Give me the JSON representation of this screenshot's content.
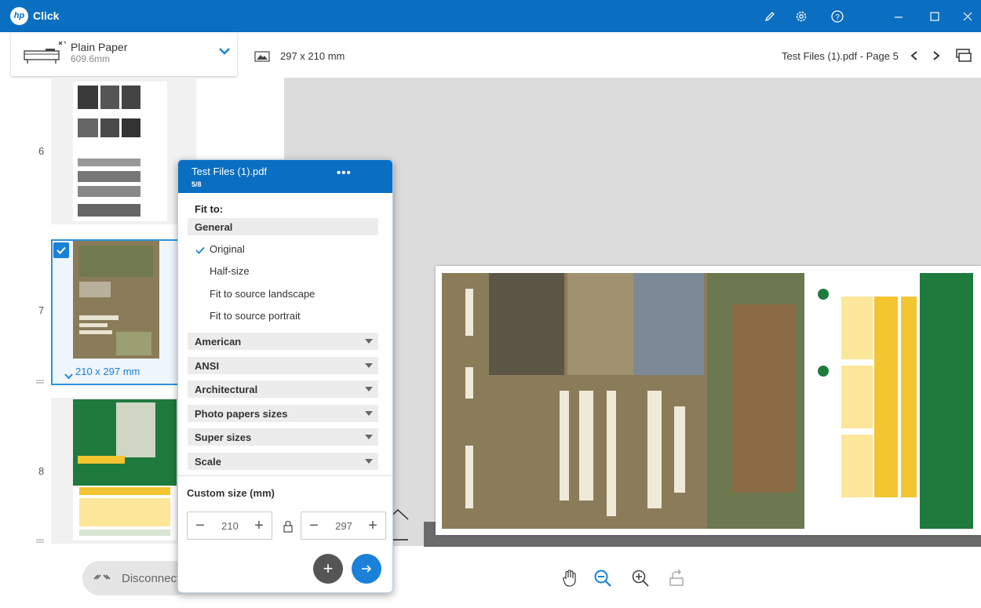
{
  "app": {
    "title": "Click",
    "logo_text": "hp"
  },
  "window_controls": [
    "pen-icon",
    "gear-icon",
    "help-icon",
    "minimize-icon",
    "maximize-icon",
    "close-icon"
  ],
  "paper": {
    "name": "Plain Paper",
    "width": "609.6mm"
  },
  "doc_size": "297 x 210 mm",
  "page_label": "Test Files (1).pdf - Page 5",
  "thumbnails": [
    {
      "number": "6"
    },
    {
      "number": "7",
      "size": "210 x 297 mm",
      "selected": true
    },
    {
      "number": "8"
    }
  ],
  "disconnect_label": "Disconnected",
  "popup": {
    "title": "Test Files (1).pdf",
    "count": "5/8",
    "more": "•••",
    "fit_to": "Fit to:",
    "general": "General",
    "options": [
      "Original",
      "Half-size",
      "Fit to source landscape",
      "Fit to source portrait"
    ],
    "selected_option": "Original",
    "groups": [
      "American",
      "ANSI",
      "Architectural",
      "Photo papers sizes",
      "Super sizes",
      "Scale"
    ],
    "custom_size_label": "Custom size (mm)",
    "width_value": "210",
    "height_value": "297"
  },
  "colors": {
    "brand_blue": "#0a6ec1",
    "accent_blue": "#1a80d8",
    "flyer_olive": "#8a7c59"
  }
}
